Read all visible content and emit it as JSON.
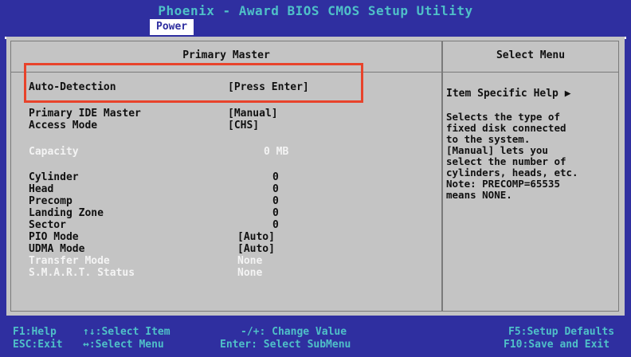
{
  "header": {
    "title": "Phoenix - Award BIOS CMOS Setup Utility",
    "active_tab": "Power"
  },
  "left_panel": {
    "title": "Primary Master",
    "rows": [
      {
        "label": "Auto-Detection",
        "value": "[Press Enter]"
      },
      {
        "label": "Primary IDE Master",
        "value": "[Manual]"
      },
      {
        "label": "Access Mode",
        "value": "[CHS]"
      },
      {
        "label": "Capacity",
        "value": "0 MB"
      },
      {
        "label": "Cylinder",
        "value": "0"
      },
      {
        "label": "Head",
        "value": "0"
      },
      {
        "label": "Precomp",
        "value": "0"
      },
      {
        "label": "Landing Zone",
        "value": "0"
      },
      {
        "label": "Sector",
        "value": "0"
      },
      {
        "label": "PIO Mode",
        "value": "[Auto]"
      },
      {
        "label": "UDMA Mode",
        "value": "[Auto]"
      },
      {
        "label": "Transfer Mode",
        "value": "None"
      },
      {
        "label": "S.M.A.R.T. Status",
        "value": "None"
      }
    ]
  },
  "right_panel": {
    "title": "Select Menu",
    "help_title": "Item Specific Help ▶",
    "help_lines": [
      "Selects the type of",
      "fixed disk connected",
      "to the system.",
      "[Manual] lets you",
      "select the number of",
      "cylinders, heads, etc.",
      "Note: PRECOMP=65535",
      "means NONE."
    ]
  },
  "footer": {
    "keys": [
      "F1:Help",
      "ESC:Exit",
      "↑↓:Select Item",
      "↔:Select Menu",
      "-/+: Change Value",
      "Enter: Select SubMenu",
      "F5:Setup Defaults",
      "F10:Save and Exit"
    ]
  },
  "colors": {
    "background": "#2f2fa0",
    "panel": "#c4c4c4",
    "footer_text": "#4fc0c8",
    "highlight_box": "#e8432b"
  }
}
